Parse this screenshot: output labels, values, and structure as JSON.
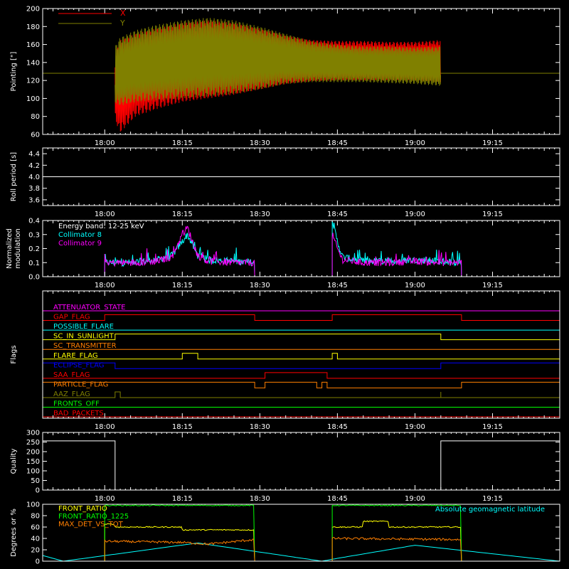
{
  "figure": {
    "background": "#000000",
    "foreground": "#ffffff",
    "x_range": [
      "17:48",
      "19:28"
    ],
    "x_ticks": [
      "18:00",
      "18:15",
      "18:30",
      "18:45",
      "19:00",
      "19:15"
    ]
  },
  "chart_data": [
    {
      "id": "pointing",
      "type": "line",
      "ylabel": "Pointing [\"]",
      "ylim": [
        60,
        200
      ],
      "yticks": [
        "60",
        "80",
        "100",
        "120",
        "140",
        "160",
        "180",
        "200"
      ],
      "legend_position": "top-left",
      "reference_line": 128,
      "series": [
        {
          "name": "X",
          "color": "#ff0000",
          "active_span": [
            "18:02",
            "19:05"
          ],
          "envelope_time": [
            "18:02",
            "18:03",
            "18:06",
            "18:10",
            "18:15",
            "18:20",
            "18:25",
            "18:30",
            "18:35",
            "18:40",
            "18:45",
            "18:50",
            "18:55",
            "19:00",
            "19:05"
          ],
          "envelope_upper": [
            150,
            165,
            172,
            178,
            184,
            187,
            184,
            178,
            170,
            165,
            164,
            164,
            163,
            163,
            165
          ],
          "envelope_lower": [
            75,
            62,
            80,
            88,
            96,
            100,
            104,
            110,
            116,
            119,
            120,
            120,
            120,
            120,
            118
          ]
        },
        {
          "name": "Y",
          "color": "#808000",
          "active_span": [
            "18:02",
            "19:05"
          ],
          "envelope_time": [
            "18:02",
            "18:03",
            "18:06",
            "18:10",
            "18:15",
            "18:20",
            "18:25",
            "18:30",
            "18:35",
            "18:40",
            "18:45",
            "18:50",
            "18:55",
            "19:00",
            "19:05"
          ],
          "envelope_upper": [
            158,
            168,
            176,
            182,
            187,
            190,
            187,
            180,
            172,
            164,
            160,
            158,
            158,
            157,
            158
          ],
          "envelope_lower": [
            95,
            92,
            96,
            98,
            100,
            102,
            105,
            110,
            116,
            118,
            118,
            118,
            117,
            116,
            114
          ]
        }
      ]
    },
    {
      "id": "roll_period",
      "type": "line",
      "ylabel": "Roll period [s]",
      "ylim": [
        3.5,
        4.5
      ],
      "yticks": [
        "3.6",
        "3.8",
        "4.0",
        "4.2",
        "4.4"
      ],
      "series": [
        {
          "color": "#ffffff",
          "x": [
            "17:48",
            "19:28"
          ],
          "y": [
            4.0,
            4.0
          ]
        }
      ]
    },
    {
      "id": "modulation",
      "type": "line",
      "ylabel": "Normalized modulation",
      "ylim": [
        0,
        0.4
      ],
      "yticks": [
        "0.0",
        "0.1",
        "0.2",
        "0.3",
        "0.4"
      ],
      "annotation": "Energy band: 12-25 keV",
      "legend_position": "top-left",
      "intervals": [
        [
          "18:00",
          "18:29"
        ],
        [
          "18:44",
          "19:09"
        ]
      ],
      "series": [
        {
          "name": "Collimator 8",
          "color": "#00ffff",
          "x": [
            "18:00",
            "18:05",
            "18:10",
            "18:13",
            "18:15",
            "18:16",
            "18:18",
            "18:20",
            "18:25",
            "18:29",
            "18:44",
            "18:45",
            "18:46",
            "18:50",
            "18:55",
            "19:00",
            "19:05",
            "19:09"
          ],
          "y": [
            0.1,
            0.1,
            0.12,
            0.15,
            0.25,
            0.3,
            0.15,
            0.12,
            0.11,
            0.1,
            0.4,
            0.25,
            0.14,
            0.11,
            0.11,
            0.12,
            0.11,
            0.1
          ]
        },
        {
          "name": "Collimator 9",
          "color": "#ff00ff",
          "x": [
            "18:00",
            "18:05",
            "18:10",
            "18:13",
            "18:15",
            "18:16",
            "18:18",
            "18:20",
            "18:25",
            "18:29",
            "18:44",
            "18:45",
            "18:46",
            "18:50",
            "18:55",
            "19:00",
            "19:05",
            "19:09"
          ],
          "y": [
            0.1,
            0.1,
            0.11,
            0.14,
            0.3,
            0.35,
            0.15,
            0.11,
            0.1,
            0.1,
            0.3,
            0.2,
            0.12,
            0.1,
            0.1,
            0.11,
            0.1,
            0.1
          ]
        }
      ]
    },
    {
      "id": "flags",
      "type": "line",
      "ylabel": "Flags",
      "series": [
        {
          "name": "ATTENUATOR_STATE",
          "color": "#ff00ff",
          "transitions": [],
          "initial": 0
        },
        {
          "name": "GAP_FLAG",
          "color": "#ff0000",
          "transitions": [
            "18:00",
            "18:29",
            "18:44",
            "19:09"
          ],
          "initial": 0
        },
        {
          "name": "POSSIBLE_FLARE",
          "color": "#00ffff",
          "transitions": [],
          "initial": 0
        },
        {
          "name": "SC_IN_SUNLIGHT",
          "color": "#ffff00",
          "transitions": [
            "18:02",
            "19:05"
          ],
          "initial": 0
        },
        {
          "name": "SC_TRANSMITTER",
          "color": "#ff7f00",
          "transitions": [],
          "initial": 0
        },
        {
          "name": "FLARE_FLAG",
          "color": "#ffff00",
          "transitions": [
            "18:15",
            "18:18",
            "18:44",
            "18:45"
          ],
          "initial": 0
        },
        {
          "name": "ECLIPSE_FLAG",
          "color": "#0000ff",
          "transitions": [
            "18:02",
            "19:05"
          ],
          "initial": 1
        },
        {
          "name": "SAA_FLAG",
          "color": "#ff0000",
          "transitions": [
            "18:31",
            "18:43"
          ],
          "initial": 0
        },
        {
          "name": "PARTICLE_FLAG",
          "color": "#ff7f00",
          "transitions": [
            "18:29",
            "18:31",
            "18:41",
            "18:42",
            "18:43",
            "19:09"
          ],
          "initial": 1
        },
        {
          "name": "AAZ_FLAG",
          "color": "#808000",
          "transitions": [
            "18:02",
            "18:03",
            "19:05",
            "19:05"
          ],
          "initial": 0
        },
        {
          "name": "FRONTS_OFF",
          "color": "#00ff00",
          "transitions": [],
          "initial": 0
        },
        {
          "name": "BAD_PACKETS",
          "color": "#ff0000",
          "transitions": [],
          "initial": 0
        }
      ]
    },
    {
      "id": "quality",
      "type": "line",
      "ylabel": "Quality",
      "ylim": [
        0,
        300
      ],
      "yticks": [
        "0",
        "50",
        "100",
        "150",
        "200",
        "250",
        "300"
      ],
      "series": [
        {
          "color": "#ffffff",
          "x": [
            "17:48",
            "18:02",
            "18:02",
            "19:05",
            "19:05",
            "19:28"
          ],
          "y": [
            256,
            256,
            0,
            0,
            256,
            256
          ]
        }
      ]
    },
    {
      "id": "ratios",
      "type": "line",
      "ylabel": "Degrees or %",
      "ylim": [
        0,
        100
      ],
      "yticks": [
        "0",
        "20",
        "40",
        "60",
        "80",
        "100"
      ],
      "intervals": [
        [
          "18:00",
          "18:29"
        ],
        [
          "18:44",
          "19:09"
        ]
      ],
      "right_label": "Absolute geomagnetic latitude",
      "series": [
        {
          "name": "FRONT_RATIO",
          "color": "#ffff00",
          "x": [
            "18:00",
            "18:02",
            "18:02",
            "18:15",
            "18:15",
            "18:29",
            "18:44",
            "18:50",
            "18:50",
            "18:55",
            "18:55",
            "19:09"
          ],
          "y": [
            65,
            65,
            60,
            60,
            55,
            55,
            60,
            60,
            70,
            70,
            60,
            60
          ]
        },
        {
          "name": "FRONT_RATIO_1225",
          "color": "#00ff00",
          "x": [
            "18:00",
            "18:29",
            "18:44",
            "19:09"
          ],
          "y": [
            98,
            98,
            98,
            98
          ]
        },
        {
          "name": "MAX_DET_VS_TOT",
          "color": "#ff7f00",
          "x": [
            "18:00",
            "18:15",
            "18:20",
            "18:29",
            "18:44",
            "19:09"
          ],
          "y": [
            35,
            33,
            30,
            38,
            40,
            38
          ]
        },
        {
          "name": "Absolute geomagnetic latitude",
          "color": "#00ffff",
          "x": [
            "17:48",
            "17:52",
            "18:18",
            "18:42",
            "18:45",
            "19:00",
            "19:28"
          ],
          "y": [
            10,
            0,
            32,
            0,
            5,
            28,
            0
          ]
        }
      ]
    }
  ]
}
